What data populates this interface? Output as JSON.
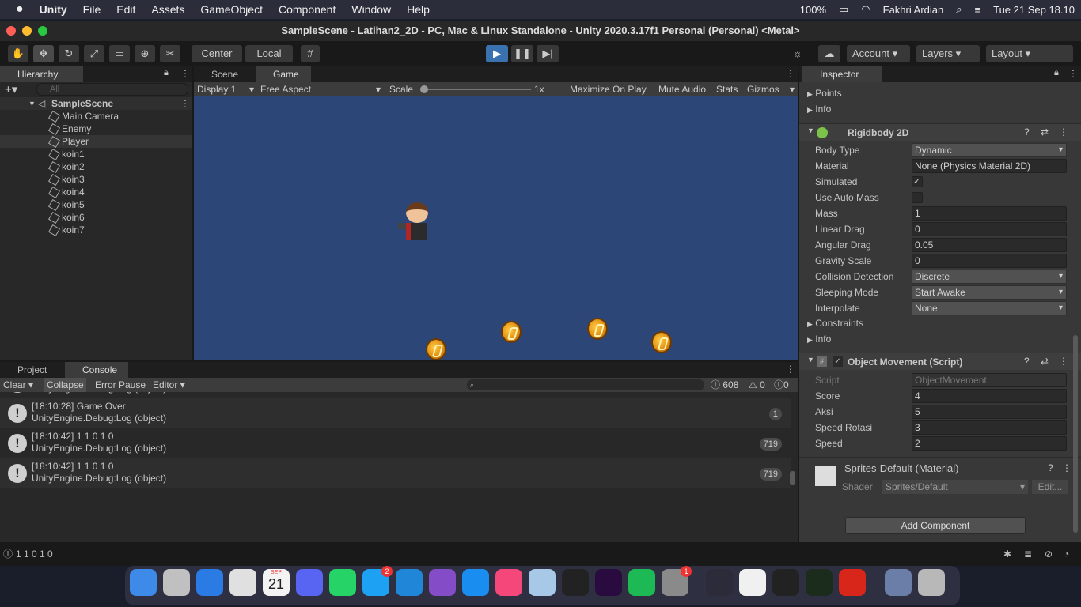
{
  "menubar": {
    "app_name": "Unity",
    "items": [
      "File",
      "Edit",
      "Assets",
      "GameObject",
      "Component",
      "Window",
      "Help"
    ],
    "battery": "100%",
    "user": "Fakhri Ardian",
    "datetime": "Tue 21 Sep  18.10"
  },
  "window": {
    "title": "SampleScene - Latihan2_2D - PC, Mac & Linux Standalone - Unity 2020.3.17f1 Personal (Personal) <Metal>"
  },
  "toolbar": {
    "pivot_center": "Center",
    "pivot_local": "Local",
    "account": "Account",
    "layers": "Layers",
    "layout": "Layout"
  },
  "hierarchy": {
    "tab": "Hierarchy",
    "search_placeholder": "All",
    "scene": "SampleScene",
    "items": [
      "Main Camera",
      "Enemy",
      "Player",
      "koin1",
      "koin2",
      "koin3",
      "koin4",
      "koin5",
      "koin6",
      "koin7"
    ]
  },
  "game": {
    "tabs": [
      "Scene",
      "Game"
    ],
    "display": "Display 1",
    "aspect": "Free Aspect",
    "scale_label": "Scale",
    "scale_value": "1x",
    "maximize": "Maximize On Play",
    "mute": "Mute Audio",
    "stats": "Stats",
    "gizmos": "Gizmos"
  },
  "inspector": {
    "tab": "Inspector",
    "points": "Points",
    "info": "Info",
    "rigidbody_title": "Rigidbody 2D",
    "rigidbody_fields": [
      {
        "label": "Body Type",
        "value": "Dynamic"
      },
      {
        "label": "Material",
        "value": "None (Physics Material 2D)"
      },
      {
        "label": "Simulated",
        "value": "✓"
      },
      {
        "label": "Use Auto Mass",
        "value": ""
      },
      {
        "label": "Mass",
        "value": "1"
      },
      {
        "label": "Linear Drag",
        "value": "0"
      },
      {
        "label": "Angular Drag",
        "value": "0.05"
      },
      {
        "label": "Gravity Scale",
        "value": "0"
      },
      {
        "label": "Collision Detection",
        "value": "Discrete"
      },
      {
        "label": "Sleeping Mode",
        "value": "Start Awake"
      },
      {
        "label": "Interpolate",
        "value": "None"
      }
    ],
    "constraints": "Constraints",
    "script_title": "Object Movement (Script)",
    "script_fields": [
      {
        "label": "Script",
        "value": "ObjectMovement"
      },
      {
        "label": "Score",
        "value": "4"
      },
      {
        "label": "Aksi",
        "value": "5"
      },
      {
        "label": "Speed Rotasi",
        "value": "3"
      },
      {
        "label": "Speed",
        "value": "2"
      }
    ],
    "material_title": "Sprites-Default (Material)",
    "shader_label": "Shader",
    "shader_value": "Sprites/Default",
    "edit": "Edit...",
    "add_component": "Add Component"
  },
  "console": {
    "tabs": [
      "Project",
      "Console"
    ],
    "clear": "Clear",
    "collapse": "Collapse",
    "error_pause": "Error Pause",
    "editor": "Editor",
    "log_count": "608",
    "warn_count": "0",
    "error_count": "0",
    "entries": [
      {
        "line1": "",
        "line2": "UnityEngine.Debug:Log (object)",
        "count": ""
      },
      {
        "line1": "[18:10:28] Game Over",
        "line2": "UnityEngine.Debug:Log (object)",
        "count": "1"
      },
      {
        "line1": "[18:10:42] 1 1 0 1 0",
        "line2": "UnityEngine.Debug:Log (object)",
        "count": "719"
      },
      {
        "line1": "[18:10:42] 1 1 0 1 0",
        "line2": "UnityEngine.Debug:Log (object)",
        "count": "719"
      }
    ],
    "status": "1 1 0 1 0"
  },
  "dock": {
    "calendar_month": "SEP",
    "calendar_day": "21",
    "twitter_badge": "2",
    "settings_badge": "1"
  }
}
